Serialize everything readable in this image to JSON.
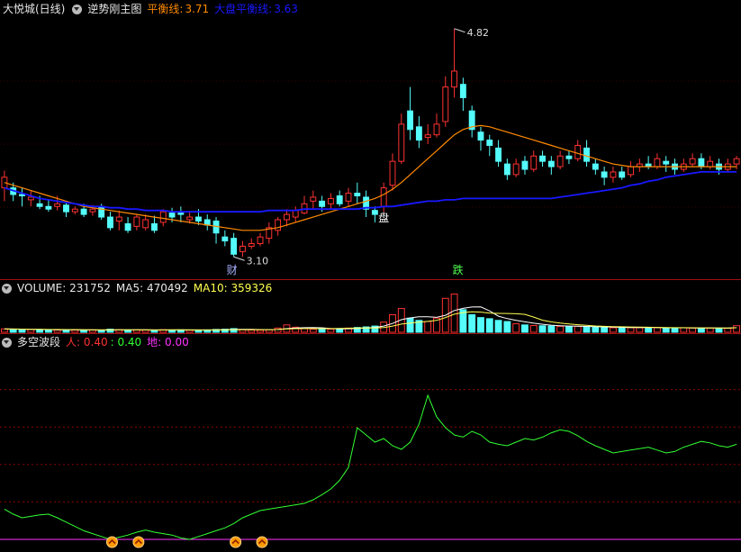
{
  "main": {
    "stock_name": "大悦城(日线)",
    "indicator": "逆势刚主图",
    "line1_label": "平衡线:",
    "line1_value": "3.71",
    "line2_label": "大盘平衡线:",
    "line2_value": "3.63",
    "high_label": "4.82",
    "low_label": "3.10",
    "marker_cai": "财",
    "marker_pan": "盘",
    "marker_die": "跌",
    "colors": {
      "up": "#ff3232",
      "down": "#54fcfc",
      "line1": "#ff8a00",
      "line2": "#1818ff"
    }
  },
  "volume": {
    "title": "VOLUME: 231752",
    "ma5": "MA5: 470492",
    "ma10": "MA10: 359326"
  },
  "wave": {
    "title": "多空波段",
    "ren": "人: 0.40",
    "mid": ": 0.40",
    "di": "地: 0.00"
  },
  "chart_data": {
    "type": "line",
    "title": "",
    "price_ylim": [
      3.0,
      4.9
    ],
    "candles": [
      [
        3.62,
        3.7,
        3.75,
        3.52
      ],
      [
        3.62,
        3.57,
        3.66,
        3.52
      ],
      [
        3.57,
        3.56,
        3.62,
        3.48
      ],
      [
        3.53,
        3.55,
        3.6,
        3.48
      ],
      [
        3.5,
        3.48,
        3.56,
        3.46
      ],
      [
        3.48,
        3.46,
        3.53,
        3.44
      ],
      [
        3.48,
        3.5,
        3.56,
        3.45
      ],
      [
        3.49,
        3.44,
        3.52,
        3.4
      ],
      [
        3.44,
        3.46,
        3.48,
        3.42
      ],
      [
        3.46,
        3.42,
        3.5,
        3.4
      ],
      [
        3.44,
        3.46,
        3.49,
        3.41
      ],
      [
        3.48,
        3.4,
        3.5,
        3.38
      ],
      [
        3.4,
        3.32,
        3.44,
        3.3
      ],
      [
        3.37,
        3.4,
        3.45,
        3.3
      ],
      [
        3.35,
        3.3,
        3.4,
        3.28
      ],
      [
        3.33,
        3.4,
        3.42,
        3.3
      ],
      [
        3.32,
        3.38,
        3.42,
        3.3
      ],
      [
        3.35,
        3.3,
        3.41,
        3.28
      ],
      [
        3.36,
        3.44,
        3.46,
        3.33
      ],
      [
        3.43,
        3.4,
        3.47,
        3.36
      ],
      [
        3.43,
        3.42,
        3.48,
        3.36
      ],
      [
        3.38,
        3.4,
        3.44,
        3.35
      ],
      [
        3.4,
        3.37,
        3.46,
        3.34
      ],
      [
        3.38,
        3.34,
        3.42,
        3.3
      ],
      [
        3.37,
        3.28,
        3.4,
        3.2
      ],
      [
        3.25,
        3.22,
        3.3,
        3.18
      ],
      [
        3.24,
        3.12,
        3.28,
        3.1
      ],
      [
        3.14,
        3.18,
        3.22,
        3.1
      ],
      [
        3.18,
        3.2,
        3.24,
        3.16
      ],
      [
        3.2,
        3.25,
        3.28,
        3.18
      ],
      [
        3.24,
        3.32,
        3.36,
        3.2
      ],
      [
        3.3,
        3.38,
        3.4,
        3.26
      ],
      [
        3.38,
        3.42,
        3.46,
        3.33
      ],
      [
        3.4,
        3.45,
        3.48,
        3.36
      ],
      [
        3.43,
        3.5,
        3.56,
        3.42
      ],
      [
        3.52,
        3.55,
        3.6,
        3.46
      ],
      [
        3.52,
        3.48,
        3.56,
        3.44
      ],
      [
        3.5,
        3.54,
        3.58,
        3.46
      ],
      [
        3.56,
        3.5,
        3.6,
        3.48
      ],
      [
        3.52,
        3.58,
        3.62,
        3.48
      ],
      [
        3.58,
        3.56,
        3.66,
        3.5
      ],
      [
        3.55,
        3.46,
        3.6,
        3.4
      ],
      [
        3.45,
        3.42,
        3.48,
        3.36
      ],
      [
        3.48,
        3.62,
        3.66,
        3.44
      ],
      [
        3.64,
        3.82,
        3.88,
        3.6
      ],
      [
        3.82,
        4.1,
        4.18,
        3.8
      ],
      [
        4.2,
        4.06,
        4.38,
        3.98
      ],
      [
        4.08,
        3.98,
        4.16,
        3.92
      ],
      [
        4.0,
        4.02,
        4.1,
        3.95
      ],
      [
        4.02,
        4.1,
        4.18,
        4.0
      ],
      [
        4.12,
        4.38,
        4.46,
        4.08
      ],
      [
        4.38,
        4.5,
        4.82,
        4.3
      ],
      [
        4.4,
        4.3,
        4.45,
        4.2
      ],
      [
        4.2,
        4.06,
        4.24,
        4.0
      ],
      [
        4.04,
        3.98,
        4.08,
        3.9
      ],
      [
        3.98,
        3.94,
        4.02,
        3.86
      ],
      [
        3.92,
        3.82,
        3.98,
        3.78
      ],
      [
        3.8,
        3.72,
        3.84,
        3.68
      ],
      [
        3.72,
        3.8,
        3.84,
        3.7
      ],
      [
        3.82,
        3.76,
        3.86,
        3.72
      ],
      [
        3.76,
        3.86,
        3.9,
        3.74
      ],
      [
        3.86,
        3.82,
        3.9,
        3.78
      ],
      [
        3.82,
        3.78,
        3.86,
        3.72
      ],
      [
        3.78,
        3.86,
        3.9,
        3.76
      ],
      [
        3.86,
        3.84,
        3.9,
        3.8
      ],
      [
        3.84,
        3.94,
        3.98,
        3.82
      ],
      [
        3.92,
        3.82,
        3.98,
        3.78
      ],
      [
        3.8,
        3.76,
        3.84,
        3.72
      ],
      [
        3.74,
        3.7,
        3.78,
        3.64
      ],
      [
        3.7,
        3.74,
        3.78,
        3.66
      ],
      [
        3.74,
        3.7,
        3.78,
        3.68
      ],
      [
        3.72,
        3.78,
        3.82,
        3.7
      ],
      [
        3.78,
        3.8,
        3.84,
        3.74
      ],
      [
        3.8,
        3.78,
        3.86,
        3.76
      ],
      [
        3.78,
        3.84,
        3.88,
        3.76
      ],
      [
        3.82,
        3.8,
        3.86,
        3.74
      ],
      [
        3.8,
        3.76,
        3.84,
        3.72
      ],
      [
        3.76,
        3.8,
        3.84,
        3.74
      ],
      [
        3.8,
        3.84,
        3.88,
        3.78
      ],
      [
        3.84,
        3.78,
        3.88,
        3.76
      ],
      [
        3.78,
        3.82,
        3.86,
        3.76
      ],
      [
        3.8,
        3.76,
        3.84,
        3.72
      ],
      [
        3.76,
        3.8,
        3.84,
        3.74
      ],
      [
        3.8,
        3.84,
        3.86,
        3.76
      ]
    ],
    "line1": [
      3.66,
      3.64,
      3.62,
      3.6,
      3.58,
      3.56,
      3.54,
      3.52,
      3.5,
      3.48,
      3.47,
      3.46,
      3.45,
      3.44,
      3.43,
      3.42,
      3.41,
      3.4,
      3.39,
      3.38,
      3.37,
      3.36,
      3.35,
      3.34,
      3.33,
      3.32,
      3.31,
      3.3,
      3.3,
      3.3,
      3.31,
      3.32,
      3.34,
      3.36,
      3.38,
      3.4,
      3.42,
      3.44,
      3.46,
      3.48,
      3.5,
      3.52,
      3.54,
      3.57,
      3.61,
      3.66,
      3.72,
      3.78,
      3.84,
      3.9,
      3.96,
      4.02,
      4.06,
      4.08,
      4.09,
      4.08,
      4.06,
      4.04,
      4.02,
      4.0,
      3.98,
      3.96,
      3.94,
      3.92,
      3.9,
      3.88,
      3.86,
      3.84,
      3.82,
      3.8,
      3.79,
      3.78,
      3.78,
      3.78,
      3.78,
      3.78,
      3.78,
      3.78,
      3.78,
      3.78,
      3.78,
      3.78,
      3.78,
      3.78
    ],
    "line2": [
      3.62,
      3.6,
      3.58,
      3.56,
      3.54,
      3.53,
      3.52,
      3.51,
      3.5,
      3.49,
      3.48,
      3.48,
      3.47,
      3.47,
      3.46,
      3.46,
      3.45,
      3.45,
      3.45,
      3.44,
      3.44,
      3.44,
      3.44,
      3.44,
      3.44,
      3.44,
      3.44,
      3.44,
      3.44,
      3.44,
      3.45,
      3.45,
      3.45,
      3.45,
      3.46,
      3.46,
      3.46,
      3.46,
      3.46,
      3.46,
      3.46,
      3.47,
      3.47,
      3.48,
      3.48,
      3.49,
      3.5,
      3.51,
      3.52,
      3.52,
      3.53,
      3.53,
      3.54,
      3.54,
      3.54,
      3.54,
      3.54,
      3.54,
      3.54,
      3.54,
      3.54,
      3.54,
      3.54,
      3.55,
      3.56,
      3.57,
      3.58,
      3.59,
      3.6,
      3.61,
      3.62,
      3.64,
      3.65,
      3.67,
      3.68,
      3.7,
      3.71,
      3.72,
      3.73,
      3.74,
      3.74,
      3.74,
      3.74,
      3.74
    ],
    "volume_max": 1400000,
    "volumes": [
      120000,
      110000,
      100000,
      95000,
      90000,
      85000,
      80000,
      90000,
      80000,
      75000,
      85000,
      70000,
      110000,
      90000,
      80000,
      85000,
      80000,
      75000,
      90000,
      80000,
      85000,
      75000,
      80000,
      85000,
      100000,
      110000,
      130000,
      90000,
      80000,
      75000,
      90000,
      150000,
      260000,
      180000,
      130000,
      110000,
      120000,
      110000,
      130000,
      150000,
      170000,
      190000,
      220000,
      360000,
      620000,
      840000,
      500000,
      420000,
      380000,
      500000,
      1200000,
      1350000,
      800000,
      620000,
      520000,
      480000,
      420000,
      380000,
      300000,
      260000,
      240000,
      230000,
      220000,
      210000,
      200000,
      210000,
      190000,
      180000,
      170000,
      160000,
      170000,
      160000,
      160000,
      170000,
      160000,
      150000,
      150000,
      160000,
      150000,
      140000,
      150000,
      145000,
      140000,
      231752
    ],
    "ma5": [
      100000,
      100000,
      100000,
      100000,
      100000,
      100000,
      100000,
      100000,
      100000,
      100000,
      100000,
      100000,
      100000,
      100000,
      100000,
      100000,
      100000,
      100000,
      100000,
      100000,
      100000,
      100000,
      100000,
      100000,
      100000,
      100000,
      100000,
      100000,
      100000,
      100000,
      100000,
      100000,
      100000,
      100000,
      100000,
      100000,
      100000,
      100000,
      100000,
      100000,
      100000,
      100000,
      100000,
      100000,
      100000,
      100000,
      100000,
      100000,
      100000,
      100000,
      100000,
      100000,
      100000,
      100000,
      100000,
      100000,
      100000,
      100000,
      100000,
      100000,
      100000,
      100000,
      100000,
      100000,
      100000,
      100000,
      100000,
      100000,
      100000,
      100000,
      100000,
      100000,
      100000,
      100000,
      100000,
      100000,
      100000,
      100000,
      100000,
      100000,
      100000,
      100000,
      100000,
      100000
    ],
    "wave": [
      0.42,
      0.35,
      0.3,
      0.32,
      0.34,
      0.35,
      0.3,
      0.24,
      0.18,
      0.12,
      0.08,
      0.04,
      0.0,
      0.03,
      0.06,
      0.1,
      0.13,
      0.1,
      0.08,
      0.06,
      0.02,
      0.0,
      0.04,
      0.08,
      0.12,
      0.16,
      0.22,
      0.3,
      0.35,
      0.4,
      0.42,
      0.44,
      0.46,
      0.48,
      0.5,
      0.55,
      0.62,
      0.7,
      0.82,
      1.0,
      1.55,
      1.45,
      1.35,
      1.4,
      1.3,
      1.25,
      1.35,
      1.6,
      2.0,
      1.7,
      1.55,
      1.45,
      1.42,
      1.5,
      1.45,
      1.35,
      1.32,
      1.3,
      1.35,
      1.4,
      1.38,
      1.42,
      1.48,
      1.52,
      1.5,
      1.44,
      1.36,
      1.3,
      1.25,
      1.2,
      1.22,
      1.24,
      1.26,
      1.28,
      1.24,
      1.2,
      1.22,
      1.28,
      1.32,
      1.36,
      1.34,
      1.3,
      1.28,
      1.32
    ],
    "wave_ylim": [
      0,
      2.6
    ]
  }
}
